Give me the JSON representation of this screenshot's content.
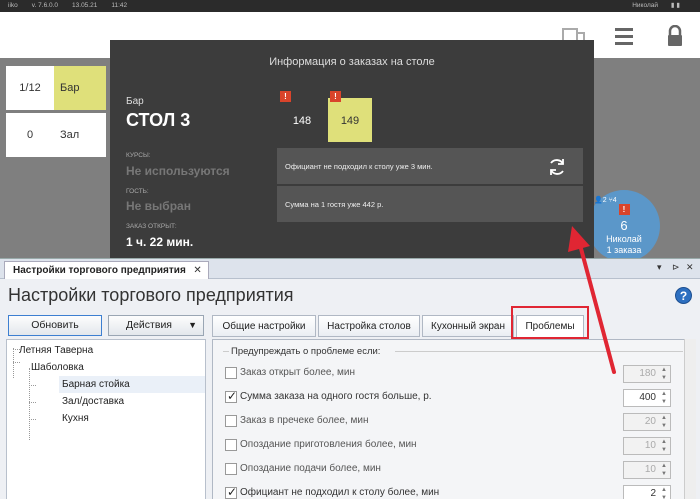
{
  "topbar": {
    "app": "iiko",
    "version": "v. 7.6.0.0",
    "date": "13.05.21",
    "time": "11:42",
    "user": "Николай"
  },
  "tables": [
    {
      "num": "1/12",
      "name": "Бар"
    },
    {
      "num": "0",
      "name": "Зал"
    }
  ],
  "circle": {
    "guests": "2",
    "count": "4",
    "number": "6",
    "waiter": "Николай",
    "label": "1 заказа"
  },
  "popup": {
    "title": "Информация о заказах на столе",
    "group": "Бар",
    "table": "СТОЛ 3",
    "courses_label": "КУРСЫ:",
    "courses_value": "Не используются",
    "guest_label": "ГОСТЬ:",
    "guest_value": "Не выбран",
    "opened_label": "ЗАКАЗ ОТКРЫТ:",
    "opened_value": "1 ч. 22 мин.",
    "orders": [
      "148",
      "149"
    ],
    "messages": [
      "Официант не подходил к столу уже 3 мин.",
      "Сумма на 1 гостя уже 442 р."
    ]
  },
  "window": {
    "tab": "Настройки торгового предприятия",
    "title": "Настройки торгового предприятия",
    "refresh_label": "Обновить",
    "actions_label": "Действия",
    "tree": [
      "Летняя Таверна",
      "Шаболовка",
      "Барная стойка",
      "Зал/доставка",
      "Кухня"
    ],
    "tabs": [
      "Общие настройки",
      "Настройка столов",
      "Кухонный экран",
      "Проблемы"
    ],
    "section": "Предупреждать о проблеме если:",
    "rows": [
      {
        "label": "Заказ открыт более, мин",
        "checked": false,
        "value": "180"
      },
      {
        "label": "Сумма заказа на одного гостя больше, р.",
        "checked": true,
        "value": "400"
      },
      {
        "label": "Заказ в пречеке более, мин",
        "checked": false,
        "value": "20"
      },
      {
        "label": "Опоздание приготовления более, мин",
        "checked": false,
        "value": "10"
      },
      {
        "label": "Опоздание подачи более, мин",
        "checked": false,
        "value": "10"
      },
      {
        "label": "Официант не подходил к столу более, мин",
        "checked": true,
        "value": "2"
      }
    ]
  },
  "colors": {
    "accent_red": "#e02633",
    "warn": "#d9442b",
    "selected_order": "#dfe07a",
    "help_blue": "#2d6fc0"
  }
}
